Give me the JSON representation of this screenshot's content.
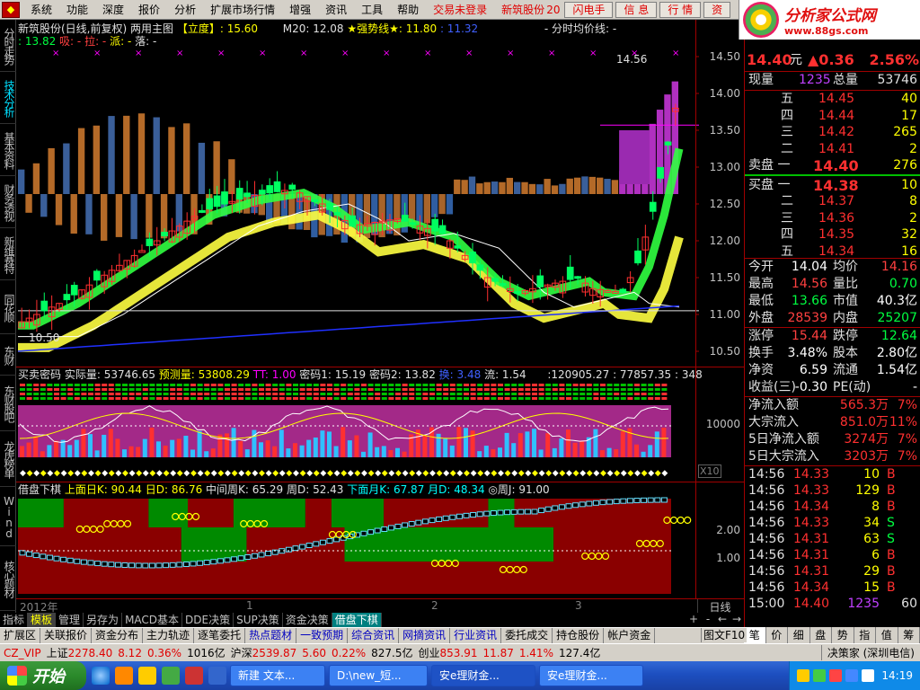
{
  "menu": {
    "items": [
      "系统",
      "功能",
      "深度",
      "报价",
      "分析",
      "扩展市场行情",
      "增强",
      "资讯",
      "工具",
      "帮助"
    ],
    "trade_status": "交易未登录",
    "stock_short": "新筑股份",
    "stock_code_fragment": "20",
    "buttons": [
      "闪电手",
      "信 息",
      "行 情",
      "资"
    ]
  },
  "brand": {
    "title": "分析家公式网",
    "url": "www.88gs.com"
  },
  "left_tabs": [
    "分时走势",
    "技术分析",
    "基本资料",
    "财务透视",
    "新维赛特",
    "同花顺10",
    "东财10",
    "东财股吧",
    "龙虎榜单",
    "Wind资讯",
    "核心题材"
  ],
  "main_chart": {
    "header": {
      "title": "新筑股份(日线,前复权) 两用主图",
      "badge": "【立度】",
      "badge_value": ": 15.60",
      "m20": "M20: 12.08",
      "strong_line": "★强势线★: 11.80",
      "strong_line2": ": 11.32",
      "avg_line": "- 分时均价线: -",
      "line2_a": ": 13.82",
      "line2_b": "吸: -",
      "line2_c": "拉: -",
      "line2_d": "派: -",
      "line2_e": "落: -"
    },
    "price_labels": [
      "14.50",
      "14.00",
      "13.50",
      "13.00",
      "12.50",
      "12.00",
      "11.50",
      "11.00",
      "10.50"
    ],
    "high_marker": "14.56",
    "low_marker": "10.50"
  },
  "sub1": {
    "header": {
      "l1": "买卖密码",
      "l2": "实际量: 53746.65",
      "l3": "预测量: 53808.29",
      "l4": "TT: 1.00",
      "l5": "密码1: 15.19",
      "l6": "密码2: 13.82",
      "l7": "换: 3.48",
      "l8": "流: 1.54",
      "l9": ":120905.27 : 77857.35 : 348"
    },
    "ylabel": "10000",
    "x10": "X10"
  },
  "sub2": {
    "header": {
      "t": "借盘下棋",
      "a": "上面日K: 90.44",
      "b": "日D: 86.76",
      "c": "中间周K: 65.29",
      "d": "周D: 52.43",
      "e": "下面月K: 67.87",
      "f": "月D: 48.34",
      "g": "◎周J: 91.00"
    },
    "ylabels": [
      "2.00",
      "1.00"
    ]
  },
  "date_axis": {
    "labels": [
      "2012年",
      "1",
      "2",
      "3"
    ],
    "period": "日线"
  },
  "chart_tabs": [
    "指标",
    "模板",
    "管理",
    "另存为",
    "MACD基本",
    "DDE决策",
    "SUP决策",
    "资金决策",
    "借盘下棋"
  ],
  "chart_tabs_nav": [
    "+",
    "-",
    "←",
    "→"
  ],
  "ext_tabs": [
    "扩展区",
    "关联报价",
    "资金分布",
    "主力轨迹",
    "逐笔委托",
    "热点题材",
    "一致预期",
    "综合资讯",
    "网摘资讯",
    "行业资讯",
    "委托成交",
    "持仓股份",
    "帐户资金"
  ],
  "quote": {
    "price": "14.40",
    "unit": "元",
    "change": "▲0.36",
    "pct": "2.56%",
    "xianliang_label": "现量",
    "xianliang": "1235",
    "zongliang_label": "总量",
    "zongliang": "53746",
    "sell": [
      {
        "label": "五",
        "price": "14.45",
        "vol": "40"
      },
      {
        "label": "四",
        "price": "14.44",
        "vol": "17"
      },
      {
        "label": "三",
        "price": "14.42",
        "vol": "265"
      },
      {
        "label": "二",
        "price": "14.41",
        "vol": "2"
      },
      {
        "label": "卖盘 一",
        "price": "14.40",
        "vol": "276"
      }
    ],
    "buy": [
      {
        "label": "买盘 一",
        "price": "14.38",
        "vol": "10"
      },
      {
        "label": "二",
        "price": "14.37",
        "vol": "8"
      },
      {
        "label": "三",
        "price": "14.36",
        "vol": "2"
      },
      {
        "label": "四",
        "price": "14.35",
        "vol": "32"
      },
      {
        "label": "五",
        "price": "14.34",
        "vol": "16"
      }
    ],
    "stats": [
      {
        "l1": "今开",
        "v1": "14.04",
        "c1": "#ffffff",
        "l2": "均价",
        "v2": "14.16",
        "c2": "#ff4040"
      },
      {
        "l1": "最高",
        "v1": "14.56",
        "c1": "#ff4040",
        "l2": "量比",
        "v2": "0.70",
        "c2": "#00ff40"
      },
      {
        "l1": "最低",
        "v1": "13.66",
        "c1": "#00ff40",
        "l2": "市值",
        "v2": "40.3亿",
        "c2": "#ffffff"
      },
      {
        "l1": "外盘",
        "v1": "28539",
        "c1": "#ff4040",
        "l2": "内盘",
        "v2": "25207",
        "c2": "#00ff40"
      }
    ],
    "stats2": [
      {
        "l1": "涨停",
        "v1": "15.44",
        "c1": "#ff4040",
        "l2": "跌停",
        "v2": "12.64",
        "c2": "#00ff40"
      },
      {
        "l1": "换手",
        "v1": "3.48%",
        "c1": "#ffffff",
        "l2": "股本",
        "v2": "2.80亿",
        "c2": "#ffffff"
      },
      {
        "l1": "净资",
        "v1": "6.59",
        "c1": "#ffffff",
        "l2": "流通",
        "v2": "1.54亿",
        "c2": "#ffffff"
      },
      {
        "l1": "收益(三)",
        "v1": "-0.30",
        "c1": "#ffffff",
        "l2": "PE(动)",
        "v2": "-",
        "c2": "#ffffff"
      }
    ],
    "flows": [
      {
        "label": "净流入额",
        "value": "565.3万",
        "pct": "7%"
      },
      {
        "label": "大宗流入",
        "value": "851.0万",
        "pct": "11%"
      },
      {
        "label": "5日净流入额",
        "value": "3274万",
        "pct": "7%"
      },
      {
        "label": "5日大宗流入",
        "value": "3203万",
        "pct": "7%"
      }
    ],
    "ticks": [
      {
        "t": "14:56",
        "p": "14.33",
        "v": "10",
        "d": "B"
      },
      {
        "t": "14:56",
        "p": "14.33",
        "v": "129",
        "d": "B"
      },
      {
        "t": "14:56",
        "p": "14.34",
        "v": "8",
        "d": "B"
      },
      {
        "t": "14:56",
        "p": "14.33",
        "v": "34",
        "d": "S"
      },
      {
        "t": "14:56",
        "p": "14.31",
        "v": "63",
        "d": "S"
      },
      {
        "t": "14:56",
        "p": "14.31",
        "v": "6",
        "d": "B"
      },
      {
        "t": "14:56",
        "p": "14.31",
        "v": "29",
        "d": "B"
      },
      {
        "t": "14:56",
        "p": "14.34",
        "v": "15",
        "d": "B"
      },
      {
        "t": "15:00",
        "p": "14.40",
        "v": "1235",
        "d": ""
      }
    ],
    "ticks_last_vol": "60"
  },
  "right_tabs": [
    "笔",
    "价",
    "细",
    "盘",
    "势",
    "指",
    "值",
    "筹"
  ],
  "status": {
    "cz_vip": "CZ_VIP",
    "sh_label": "上证",
    "sh_val": "2278.40",
    "sh_chg": "8.12",
    "sh_pct": "0.36%",
    "sh_amt": "1016亿",
    "sz_label": "沪深",
    "sz_val": "2539.87",
    "sz_chg": "5.60",
    "sz_pct": "0.22%",
    "sz_amt": "827.5亿",
    "cy_label": "创业",
    "cy_val": "853.91",
    "cy_chg": "11.87",
    "cy_pct": "1.41%",
    "cy_amt": "127.4亿",
    "right": "决策家 (深圳电信)"
  },
  "rtabs_left": "图文F10",
  "taskbar": {
    "start": "开始",
    "tasks": [
      "新建 文本...",
      "D:\\new_短...",
      "安e理财金...",
      "安e理财金..."
    ],
    "time": "14:19"
  },
  "colors": {
    "up": "#ff3030",
    "down": "#00ff40",
    "bg": "#000000",
    "grid": "#a00000"
  }
}
